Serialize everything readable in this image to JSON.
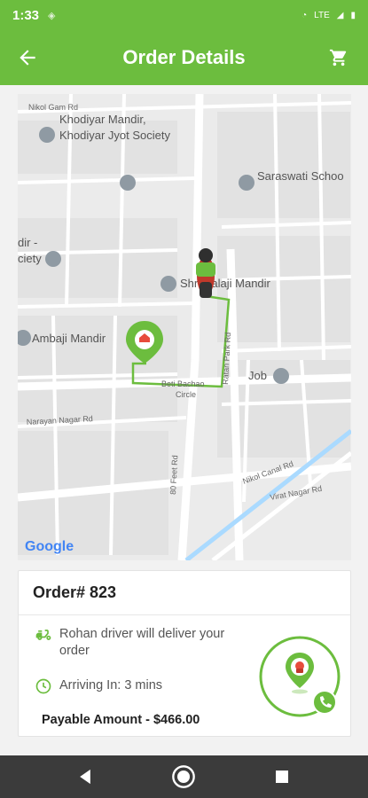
{
  "status_bar": {
    "time": "1:33",
    "signal_text": "LTE"
  },
  "header": {
    "title": "Order Details",
    "back_icon": "arrow-left-icon",
    "cart_icon": "cart-icon"
  },
  "map": {
    "labels": {
      "nikol_gam_rd": "Nikol Gam Rd",
      "khodiyar_1": "Khodiyar Mandir,",
      "khodiyar_2": "Khodiyar Jyot Society",
      "saraswati": "Saraswati Schoo",
      "dir": "dir -",
      "ciety": "ciety",
      "balaji": "Shri Balaji Mandir",
      "ambaji": "Ambaji Mandir",
      "ratan_park": "Ratan Park Rd",
      "beti_1": "Beti Bachao",
      "beti_2": "Circle",
      "job": "Job",
      "narayan": "Narayan Nagar Rd",
      "nikol_canal": "Nikol Canal Rd",
      "ft_rd": "80 Feet Rd",
      "vırat": "Virat Nagar Rd",
      "google": "Google"
    },
    "colors": {
      "route": "#6cbd3e",
      "road": "#ffffff",
      "block": "#e5e5e5",
      "water": "#aadaff"
    }
  },
  "order": {
    "title": "Order# 823",
    "driver_text": "Rohan driver will deliver your order",
    "arriving_text": "Arriving In: 3 mins",
    "payable_text": "Payable Amount - $466.00"
  },
  "accent": "#6cbd3e"
}
